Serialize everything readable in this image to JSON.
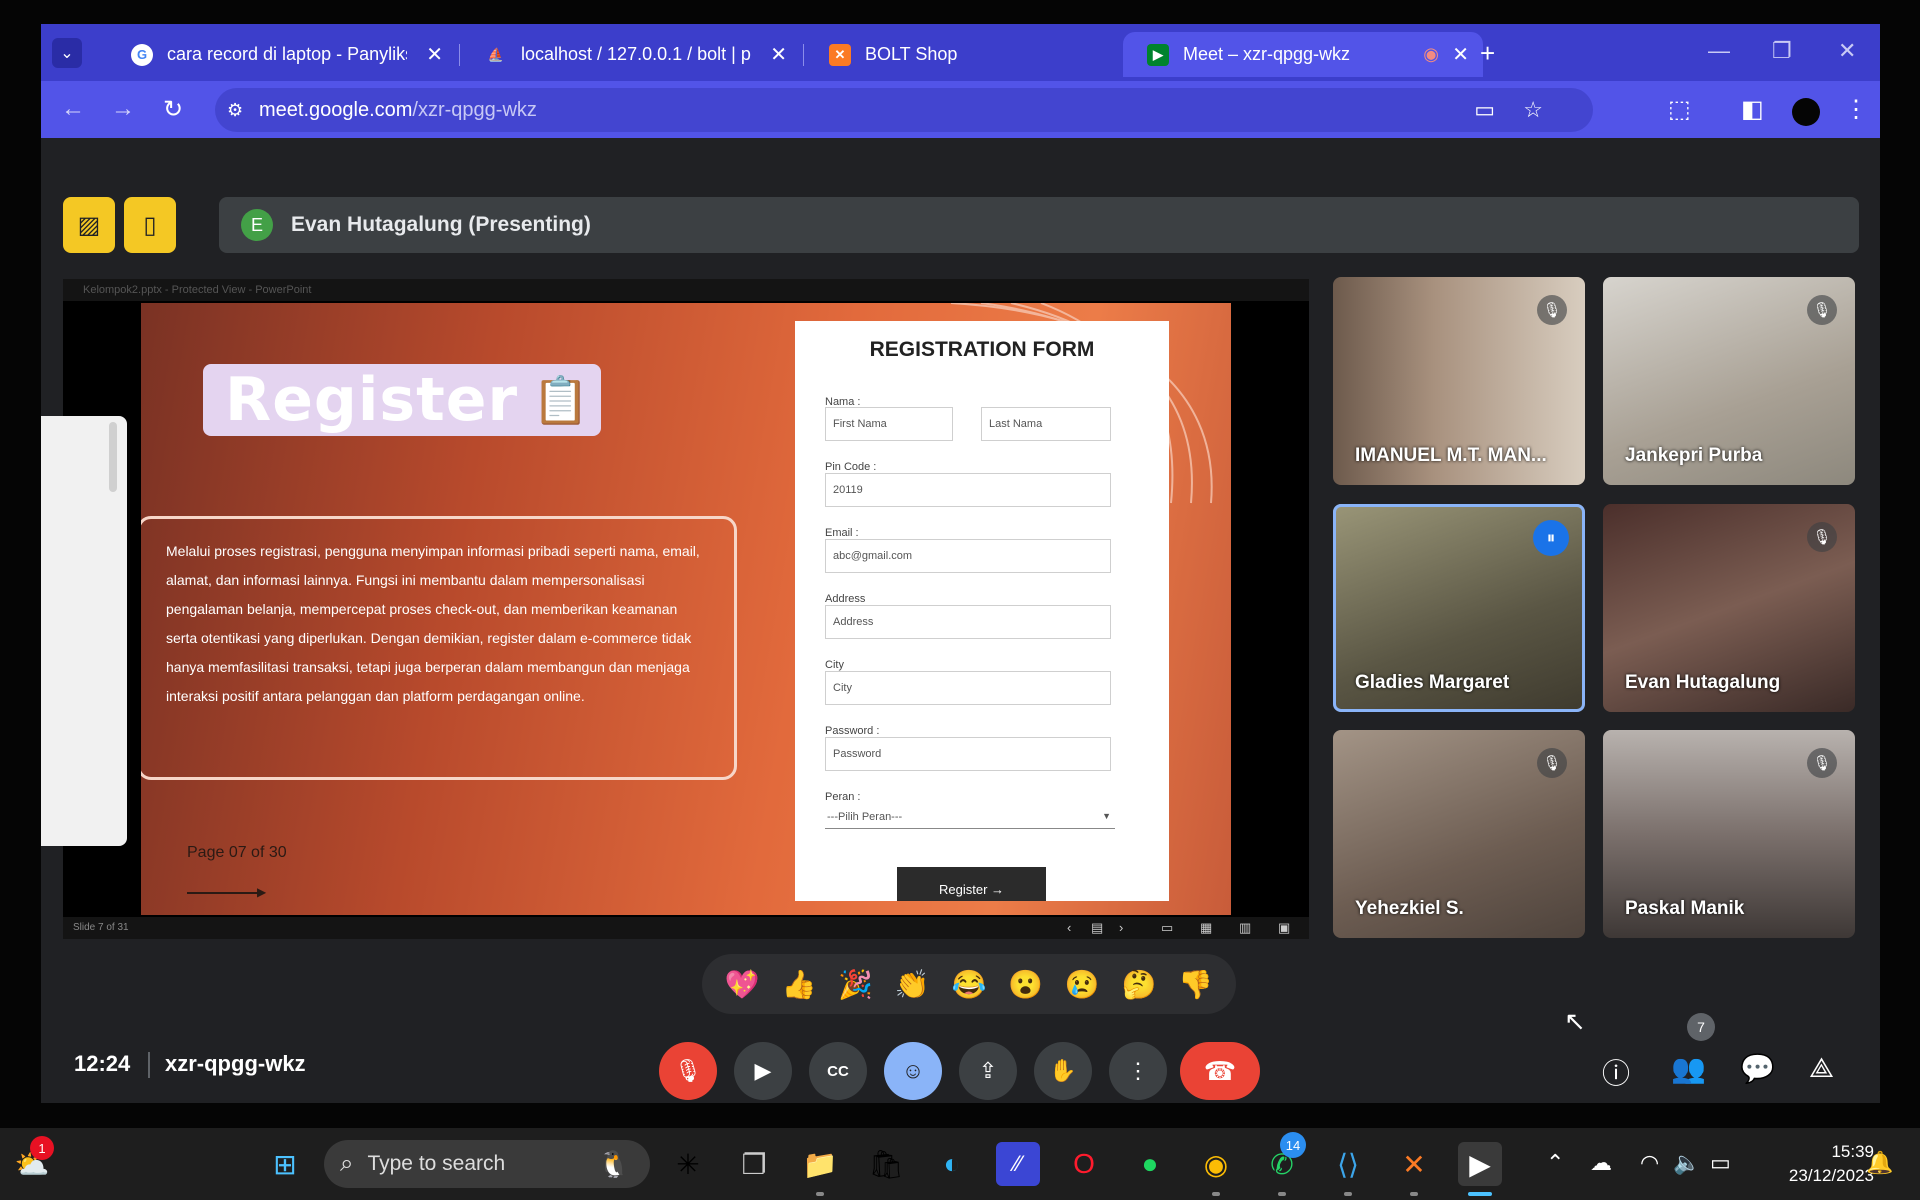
{
  "browser": {
    "tabs": [
      {
        "title": "cara record di laptop - Panyliksi",
        "favicon": "google-icon"
      },
      {
        "title": "localhost / 127.0.0.1 / bolt | php",
        "favicon": "phpmyadmin-icon"
      },
      {
        "title": "BOLT Shop",
        "favicon": "xampp-icon"
      },
      {
        "title": "Meet – xzr-qpgg-wkz",
        "favicon": "meet-icon"
      }
    ],
    "url_host": "meet.google.com",
    "url_path": "/xzr-qpgg-wkz"
  },
  "meet": {
    "presenter_initial": "E",
    "presenter_label": "Evan Hutagalung (Presenting)",
    "time": "12:24",
    "meeting_code": "xzr-qpgg-wkz",
    "participant_count": "7",
    "reactions": [
      "💖",
      "👍",
      "🎉",
      "👏",
      "😂",
      "😮",
      "😢",
      "🤔",
      "👎"
    ],
    "participants": [
      {
        "name": "IMANUEL M.T. MAN...",
        "muted": true,
        "bg": "#8a7464"
      },
      {
        "name": "Jankepri Purba",
        "muted": true,
        "bg": "#b9b1a6"
      },
      {
        "name": "Gladies Margaret",
        "muted": false,
        "speaking": true,
        "bg": "#6e6a55"
      },
      {
        "name": "Evan Hutagalung",
        "muted": true,
        "bg": "#6a4f47"
      },
      {
        "name": "Yehezkiel S.",
        "muted": true,
        "bg": "#8f7f72"
      },
      {
        "name": "Paskal Manik",
        "muted": true,
        "bg": "#7b7070"
      }
    ]
  },
  "slide": {
    "ppt_title": "Kelompok2.pptx - Protected View - PowerPoint",
    "heading": "Register",
    "description": "Melalui proses registrasi, pengguna menyimpan informasi pribadi seperti nama, email, alamat, dan informasi lainnya. Fungsi ini membantu dalam mempersonalisasi pengalaman belanja, mempercepat proses check-out, dan memberikan keamanan serta otentikasi yang diperlukan. Dengan demikian, register dalam e-commerce tidak hanya memfasilitasi transaksi, tetapi juga berperan dalam membangun dan menjaga interaksi positif antara pelanggan dan platform perdagangan online.",
    "page": "Page 07 of 30",
    "status": "Slide 7 of 31",
    "form": {
      "title": "REGISTRATION FORM",
      "name_label": "Nama :",
      "first_name": "First Nama",
      "last_name": "Last Nama",
      "pin_label": "Pin Code :",
      "pin_value": "20119",
      "email_label": "Email :",
      "email_value": "abc@gmail.com",
      "address_label": "Address",
      "address_value": "Address",
      "city_label": "City",
      "city_value": "City",
      "password_label": "Password :",
      "password_value": "Password",
      "role_label": "Peran :",
      "role_value": "---Pilih Peran---",
      "button": "Register →"
    }
  },
  "taskbar": {
    "search_placeholder": "Type to search",
    "weather_badge": "1",
    "whatsapp_badge": "14",
    "time": "15:39",
    "date": "23/12/2023"
  }
}
